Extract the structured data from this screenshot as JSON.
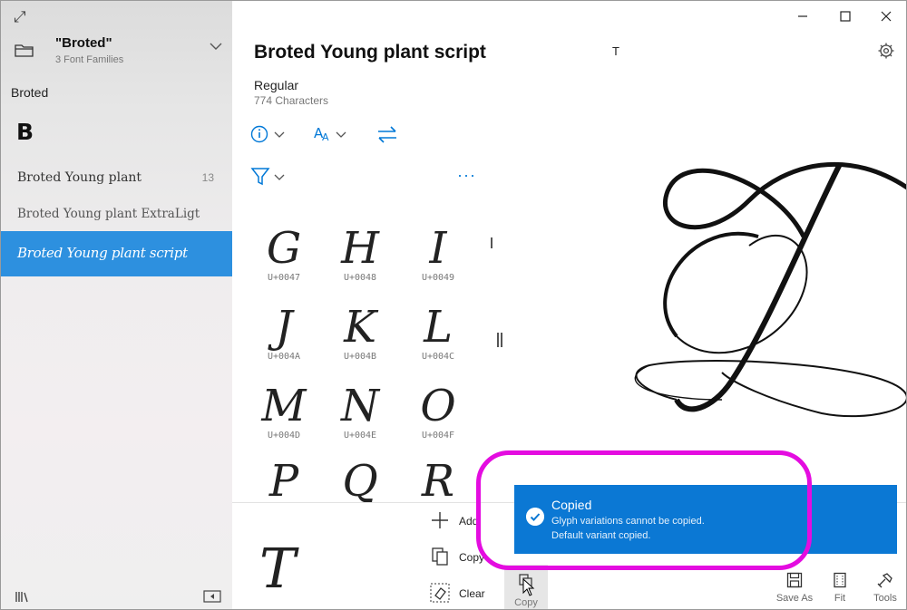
{
  "sidebar": {
    "collection_title": "\"Broted\"",
    "collection_subtitle": "3 Font Families",
    "family_name": "Broted",
    "section_letter": "B",
    "items": [
      {
        "label": "Broted Young plant",
        "count": "13"
      },
      {
        "label": "Broted Young plant ExtraLigt",
        "count": ""
      },
      {
        "label": "Broted Young plant script",
        "count": ""
      }
    ],
    "selected_color": "#2d90df"
  },
  "header": {
    "font_title": "Broted Young plant script",
    "style_name": "Regular",
    "char_count": "774 Characters",
    "selected_char": "T"
  },
  "toolbar": {
    "more_label": "···"
  },
  "glyphs": [
    {
      "char": "G",
      "code": "U+0047"
    },
    {
      "char": "H",
      "code": "U+0048"
    },
    {
      "char": "I",
      "code": "U+0049"
    },
    {
      "char": "J",
      "code": "U+004A"
    },
    {
      "char": "K",
      "code": "U+004B"
    },
    {
      "char": "L",
      "code": "U+004C"
    },
    {
      "char": "M",
      "code": "U+004D"
    },
    {
      "char": "N",
      "code": "U+004E"
    },
    {
      "char": "O",
      "code": "U+004F"
    },
    {
      "char": "P",
      "code": ""
    },
    {
      "char": "Q",
      "code": ""
    },
    {
      "char": "R",
      "code": ""
    }
  ],
  "bottom": {
    "preview_char": "T",
    "actions": [
      {
        "label": "Add",
        "icon": "plus-icon"
      },
      {
        "label": "Copy",
        "icon": "copy-icon"
      },
      {
        "label": "Clear",
        "icon": "clear-icon"
      }
    ],
    "copy_button_label": "Copy",
    "save_as_label": "Save As",
    "fit_label": "Fit",
    "tools_label": "Tools"
  },
  "toast": {
    "title": "Copied",
    "line1": "Glyph variations cannot be copied.",
    "line2": "Default variant copied.",
    "color": "#0b78d4"
  },
  "accent_color": "#0078d7",
  "highlight_color": "#e40ce0"
}
